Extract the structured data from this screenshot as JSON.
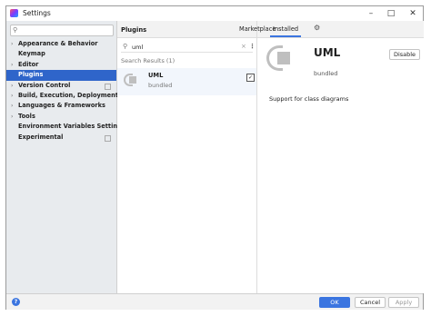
{
  "window": {
    "title": "Settings"
  },
  "sidebar": {
    "search_placeholder": "",
    "items": [
      {
        "label": "Appearance & Behavior",
        "arrow": "›",
        "selected": false
      },
      {
        "label": "Keymap",
        "arrow": "",
        "selected": false
      },
      {
        "label": "Editor",
        "arrow": "›",
        "selected": false
      },
      {
        "label": "Plugins",
        "arrow": "",
        "selected": true
      },
      {
        "label": "Version Control",
        "arrow": "›",
        "selected": false
      },
      {
        "label": "Build, Execution, Deployment",
        "arrow": "›",
        "selected": false
      },
      {
        "label": "Languages & Frameworks",
        "arrow": "›",
        "selected": false
      },
      {
        "label": "Tools",
        "arrow": "›",
        "selected": false
      },
      {
        "label": "Environment Variables Settings",
        "arrow": "",
        "selected": false
      },
      {
        "label": "Experimental",
        "arrow": "",
        "selected": false
      }
    ]
  },
  "plugins": {
    "title": "Plugins",
    "search_value": "uml",
    "results_label": "Search Results (1)",
    "result": {
      "name": "UML",
      "subtitle": "bundled",
      "enabled_mark": "✓"
    }
  },
  "tabs": {
    "marketplace": "Marketplace",
    "installed": "Installed"
  },
  "detail": {
    "name": "UML",
    "subtitle": "bundled",
    "disable_label": "Disable",
    "description": "Support for class diagrams"
  },
  "footer": {
    "help": "?",
    "ok": "OK",
    "cancel": "Cancel",
    "apply": "Apply"
  },
  "colors": {
    "accent": "#2f65ca",
    "selected_bg": "#2f65ca"
  }
}
